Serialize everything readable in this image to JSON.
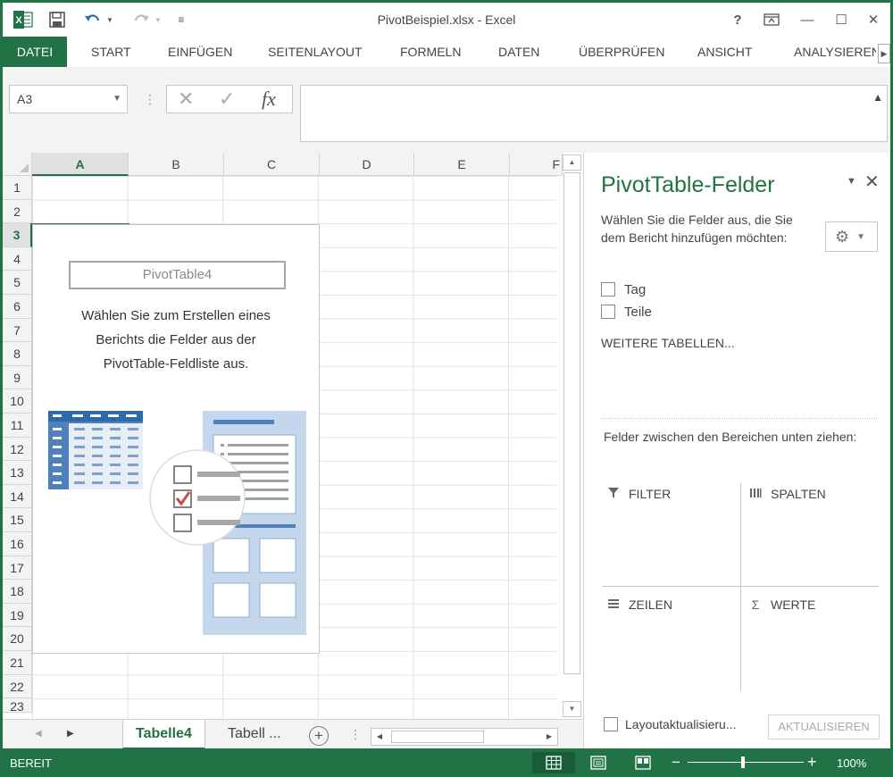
{
  "app": {
    "title": "PivotBeispiel.xlsx - Excel",
    "logo": "excel-logo"
  },
  "titlebar": {
    "help": "?",
    "restore": "⧉",
    "minimize": "—",
    "maximize": "☐",
    "close": "✕"
  },
  "ribbon": {
    "tabs": [
      "DATEI",
      "START",
      "EINFÜGEN",
      "SEITENLAYOUT",
      "FORMELN",
      "DATEN",
      "ÜBERPRÜFEN",
      "ANSICHT",
      "ANALYSIEREN"
    ],
    "active_tab": "DATEI",
    "accent": "#217346"
  },
  "formula_bar": {
    "name_box": "A3",
    "cancel": "✕",
    "confirm": "✓",
    "fx": "fx",
    "value": ""
  },
  "grid": {
    "columns": [
      "A",
      "B",
      "C",
      "D",
      "E",
      "F"
    ],
    "rows": [
      "1",
      "2",
      "3",
      "4",
      "5",
      "6",
      "7",
      "8",
      "9",
      "10",
      "11",
      "12",
      "13",
      "14",
      "15",
      "16",
      "17",
      "18",
      "19",
      "20",
      "21",
      "22",
      "23"
    ],
    "selected_cell": "A3"
  },
  "pivot_placeholder": {
    "name": "PivotTable4",
    "message_lines": [
      "Wählen Sie zum Erstellen eines",
      "Berichts die Felder aus der",
      "PivotTable-Feldliste aus."
    ]
  },
  "sheets": {
    "tabs": [
      "Tabelle4",
      "Tabell ..."
    ],
    "active": "Tabelle4",
    "add": "+"
  },
  "pivot_pane": {
    "title": "PivotTable-Felder",
    "instruction": "Wählen Sie die Felder aus, die Sie dem Bericht hinzufügen möchten:",
    "fields": [
      {
        "label": "Tag",
        "checked": false
      },
      {
        "label": "Teile",
        "checked": false
      }
    ],
    "more_tables": "WEITERE TABELLEN...",
    "drag_instruction": "Felder zwischen den Bereichen unten ziehen:",
    "areas": {
      "filter": "FILTER",
      "columns": "SPALTEN",
      "rows": "ZEILEN",
      "values": "WERTE"
    },
    "defer_update": "Layoutaktualisieru...",
    "update_button": "AKTUALISIEREN"
  },
  "status": {
    "text": "BEREIT",
    "zoom": "100%",
    "zoom_minus": "−",
    "zoom_plus": "+"
  }
}
